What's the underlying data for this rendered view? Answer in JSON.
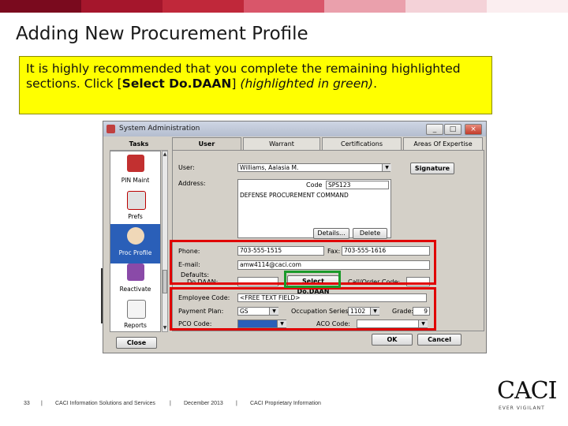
{
  "slide": {
    "title": "Adding New Procurement Profile",
    "callout_pre": "It is highly recommended that you complete the remaining highlighted sections.  Click [",
    "callout_bold": "Select Do.DAAN",
    "callout_mid": "] ",
    "callout_italic": "(highlighted in green)",
    "callout_end": "."
  },
  "colors": {
    "topbar": [
      "#7a0a1e",
      "#a5162c",
      "#c0283a",
      "#d9566a",
      "#eaa0ac",
      "#f4d2d8",
      "#fbeef0"
    ],
    "callout_bg": "#ffff00",
    "highlight_red": "#e00000",
    "highlight_green": "#1a9a2a"
  },
  "window": {
    "title": "System Administration",
    "btn_minimize": "_",
    "btn_maximize": "□",
    "btn_close": "×",
    "tasks_header": "Tasks",
    "tasks": [
      {
        "label": "PIN Maint",
        "icon": "pin-maint-icon"
      },
      {
        "label": "Prefs",
        "icon": "prefs-icon"
      },
      {
        "label": "Proc Profile",
        "icon": "proc-profile-icon",
        "selected": true
      },
      {
        "label": "Reactivate",
        "icon": "reactivate-icon"
      },
      {
        "label": "Reports",
        "icon": "reports-icon"
      }
    ],
    "tabs": [
      "User",
      "Warrant",
      "Certifications",
      "Areas Of Expertise"
    ],
    "form": {
      "user_label": "User:",
      "user_value": "Williams, Aalasia M.",
      "signature_button": "Signature",
      "address_label": "Address:",
      "code_label": "Code",
      "code_value": "SPS123",
      "address_value": "DEFENSE PROCUREMENT COMMAND",
      "details_button": "Details...",
      "delete_button": "Delete",
      "phone_label": "Phone:",
      "phone_value": "703-555-1515",
      "fax_label": "Fax:",
      "fax_value": "703-555-1616",
      "email_label": "E-mail:",
      "email_value": "amw4114@caci.com",
      "defaults_label": "Defaults:",
      "dodaan_label": "Do.DAAN:",
      "dodaan_value": "",
      "select_dodaan_button": "Select Do.DAAN",
      "call_order_label": "Call/Order Code:",
      "call_order_value": "",
      "employee_code_label": "Employee Code:",
      "employee_code_value": "<FREE TEXT FIELD>",
      "payment_plan_label": "Payment Plan:",
      "payment_plan_value": "GS",
      "occupation_series_label": "Occupation Series:",
      "occupation_series_value": "1102",
      "grade_label": "Grade:",
      "grade_value": "9",
      "pco_code_label": "PCO Code:",
      "pco_code_value": "",
      "aco_code_label": "ACO Code:",
      "aco_code_value": ""
    },
    "close_button": "Close",
    "ok_button": "OK",
    "cancel_button": "Cancel"
  },
  "footer": {
    "page_number": "33",
    "sep": "|",
    "company": "CACI Information Solutions and Services",
    "date": "December 2013",
    "proprietary": "CACI Proprietary Information"
  },
  "logo": {
    "wordmark": "CACI",
    "tagline": "EVER VIGILANT"
  }
}
